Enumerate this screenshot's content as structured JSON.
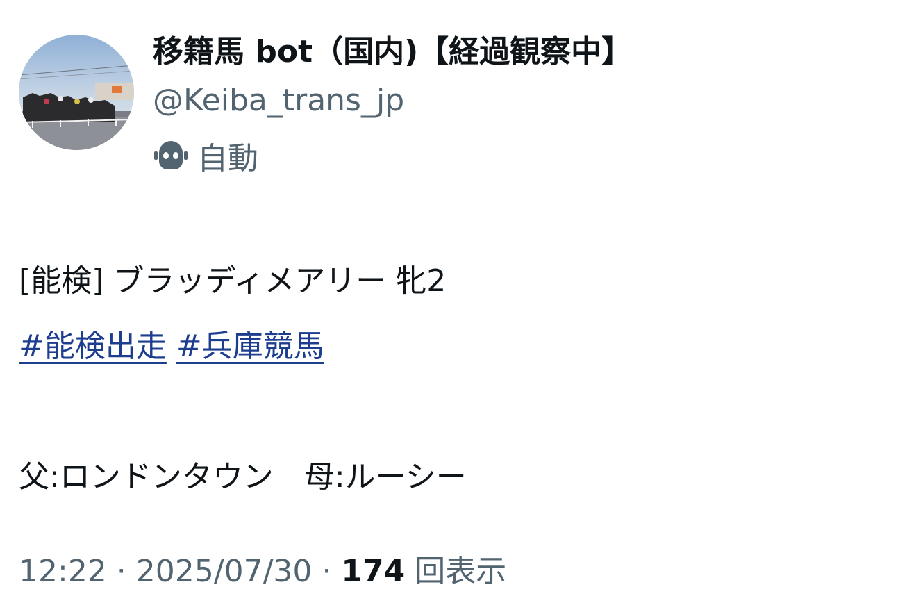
{
  "author": {
    "display_name": "移籍馬 bot（国内)【経過観察中】",
    "handle": "@Keiba_trans_jp",
    "automated_label": "自動",
    "avatar_icon": "racetrack-photo-avatar",
    "bot_icon": "robot-icon"
  },
  "tweet": {
    "line1": "[能検] ブラッディメアリー 牝2",
    "hashtags": [
      "#能検出走",
      "#兵庫競馬"
    ],
    "line3": "父:ロンドンタウン　母:ルーシー"
  },
  "meta": {
    "time": "12:22",
    "separator": " · ",
    "date": "2025/07/30",
    "views_count": "174",
    "views_label": " 回表示"
  },
  "colors": {
    "text_primary": "#0f1419",
    "text_secondary": "#536471",
    "hashtag": "#1d3d8f",
    "background": "#ffffff"
  }
}
